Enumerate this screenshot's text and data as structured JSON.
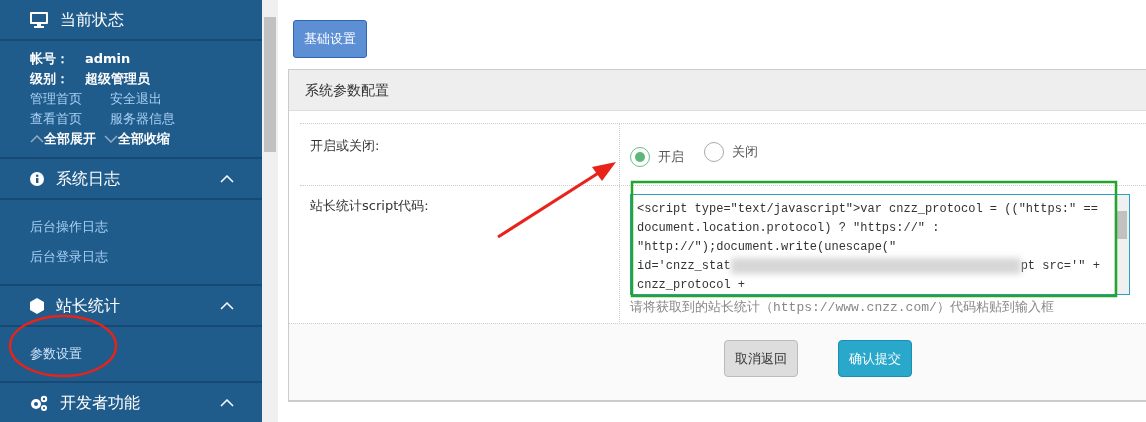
{
  "sidebar": {
    "sections": [
      {
        "title": "当前状态",
        "info": [
          {
            "label": "帐号：",
            "value": "admin"
          },
          {
            "label": "级别：",
            "value": "超级管理员"
          }
        ],
        "links": [
          "管理首页",
          "安全退出",
          "查看首页",
          "服务器信息"
        ],
        "toggles": [
          {
            "label": "全部展开"
          },
          {
            "label": "全部收缩"
          }
        ]
      },
      {
        "title": "系统日志",
        "expanded": true,
        "items": [
          {
            "label": "后台操作日志",
            "selected": false
          },
          {
            "label": "后台登录日志",
            "selected": false
          }
        ]
      },
      {
        "title": "站长统计",
        "expanded": true,
        "items": [
          {
            "label": "参数设置",
            "selected": true
          }
        ]
      },
      {
        "title": "开发者功能",
        "expanded": true
      }
    ]
  },
  "tabs": [
    {
      "label": "基础设置",
      "selected": true
    }
  ],
  "panel": {
    "title": "系统参数配置",
    "rows": [
      {
        "kind": "radio",
        "label": "开启或关闭:",
        "options": [
          {
            "label": "开启",
            "selected": true
          },
          {
            "label": "关闭",
            "selected": false
          }
        ]
      },
      {
        "kind": "code",
        "label": "站长统计script代码:",
        "lines": [
          "<script type=\"text/javascript\">var cnzz_protocol = ((\"https:\" ==",
          "document.location.protocol) ? \"https://\" :",
          "\"http://\");document.write(unescape(\"",
          "id='cnzz_stat",
          "pt src='\" +",
          "cnzz_protocol +"
        ],
        "help": {
          "before": "请将获取到的站长统计（",
          "link": "https://www.cnzz.com/",
          "after": "）代码粘贴到输入框"
        }
      }
    ],
    "buttons": [
      {
        "label": "取消返回",
        "kind": "secondary"
      },
      {
        "label": "确认提交",
        "kind": "primary"
      }
    ]
  }
}
